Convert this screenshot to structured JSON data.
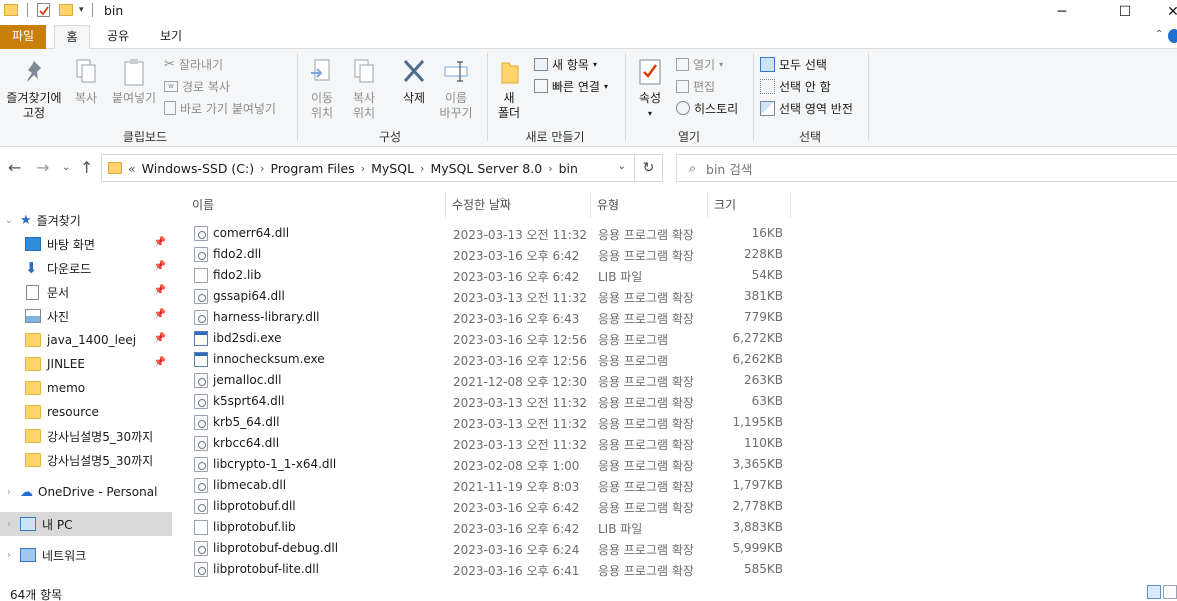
{
  "window": {
    "title": "bin",
    "minimize": "─",
    "maximize": "☐",
    "close": "✕"
  },
  "ribbon_tabs": [
    "파일",
    "홈",
    "공유",
    "보기"
  ],
  "ribbon": {
    "clipboard": {
      "pin_label": "즐겨찾기에\n고정",
      "copy_label": "복사",
      "paste_label": "붙여넣기",
      "cut_label": "잘라내기",
      "copy_path_label": "경로 복사",
      "paste_shortcut_label": "바로 가기 붙여넣기",
      "group_label": "클립보드"
    },
    "organize": {
      "move_label": "이동\n위치",
      "copyto_label": "복사\n위치",
      "delete_label": "삭제",
      "rename_label": "이름\n바꾸기",
      "group_label": "구성"
    },
    "new": {
      "new_folder_label": "새\n폴더",
      "new_item_label": "새 항목",
      "easy_access_label": "빠른 연결",
      "group_label": "새로 만들기"
    },
    "open": {
      "properties_label": "속성",
      "open_label": "열기",
      "edit_label": "편집",
      "history_label": "히스토리",
      "group_label": "열기"
    },
    "select": {
      "select_all_label": "모두 선택",
      "select_none_label": "선택 안 함",
      "invert_label": "선택 영역 반전",
      "group_label": "선택"
    }
  },
  "address": {
    "overflow": "«",
    "crumbs": [
      "Windows-SSD (C:)",
      "Program Files",
      "MySQL",
      "MySQL Server 8.0",
      "bin"
    ],
    "search_placeholder": "bin 검색"
  },
  "sidebar": {
    "items": [
      {
        "label": "즐겨찾기",
        "icon": "star-icon",
        "pinned": false
      },
      {
        "label": "바탕 화면",
        "icon": "desktop-icon",
        "pinned": true
      },
      {
        "label": "다운로드",
        "icon": "download-icon",
        "pinned": true
      },
      {
        "label": "문서",
        "icon": "document-icon",
        "pinned": true
      },
      {
        "label": "사진",
        "icon": "picture-icon",
        "pinned": true
      },
      {
        "label": "java_1400_leej",
        "icon": "folder-icon",
        "pinned": true
      },
      {
        "label": "JINLEE",
        "icon": "folder-icon",
        "pinned": true
      },
      {
        "label": "memo",
        "icon": "folder-icon",
        "pinned": false
      },
      {
        "label": "resource",
        "icon": "folder-icon",
        "pinned": false
      },
      {
        "label": "강사님설명5_30까지",
        "icon": "folder-icon",
        "pinned": false
      },
      {
        "label": "강사님설명5_30까지",
        "icon": "folder-icon",
        "pinned": false
      },
      {
        "label": "OneDrive - Personal",
        "icon": "cloud-icon",
        "pinned": false
      },
      {
        "label": "내 PC",
        "icon": "pc-icon",
        "pinned": false
      },
      {
        "label": "네트워크",
        "icon": "network-icon",
        "pinned": false
      }
    ]
  },
  "columns": {
    "name": "이름",
    "date": "수정한 날짜",
    "type": "유형",
    "size": "크기"
  },
  "files": [
    {
      "name": "comerr64.dll",
      "date": "2023-03-13 오전 11:32",
      "type": "응용 프로그램 확장",
      "size": "16KB",
      "kind": "dll"
    },
    {
      "name": "fido2.dll",
      "date": "2023-03-16 오후 6:42",
      "type": "응용 프로그램 확장",
      "size": "228KB",
      "kind": "dll"
    },
    {
      "name": "fido2.lib",
      "date": "2023-03-16 오후 6:42",
      "type": "LIB 파일",
      "size": "54KB",
      "kind": "lib"
    },
    {
      "name": "gssapi64.dll",
      "date": "2023-03-13 오전 11:32",
      "type": "응용 프로그램 확장",
      "size": "381KB",
      "kind": "dll"
    },
    {
      "name": "harness-library.dll",
      "date": "2023-03-16 오후 6:43",
      "type": "응용 프로그램 확장",
      "size": "779KB",
      "kind": "dll"
    },
    {
      "name": "ibd2sdi.exe",
      "date": "2023-03-16 오후 12:56",
      "type": "응용 프로그램",
      "size": "6,272KB",
      "kind": "exe"
    },
    {
      "name": "innochecksum.exe",
      "date": "2023-03-16 오후 12:56",
      "type": "응용 프로그램",
      "size": "6,262KB",
      "kind": "exe"
    },
    {
      "name": "jemalloc.dll",
      "date": "2021-12-08 오후 12:30",
      "type": "응용 프로그램 확장",
      "size": "263KB",
      "kind": "dll"
    },
    {
      "name": "k5sprt64.dll",
      "date": "2023-03-13 오전 11:32",
      "type": "응용 프로그램 확장",
      "size": "63KB",
      "kind": "dll"
    },
    {
      "name": "krb5_64.dll",
      "date": "2023-03-13 오전 11:32",
      "type": "응용 프로그램 확장",
      "size": "1,195KB",
      "kind": "dll"
    },
    {
      "name": "krbcc64.dll",
      "date": "2023-03-13 오전 11:32",
      "type": "응용 프로그램 확장",
      "size": "110KB",
      "kind": "dll"
    },
    {
      "name": "libcrypto-1_1-x64.dll",
      "date": "2023-02-08 오후 1:00",
      "type": "응용 프로그램 확장",
      "size": "3,365KB",
      "kind": "dll"
    },
    {
      "name": "libmecab.dll",
      "date": "2021-11-19 오후 8:03",
      "type": "응용 프로그램 확장",
      "size": "1,797KB",
      "kind": "dll"
    },
    {
      "name": "libprotobuf.dll",
      "date": "2023-03-16 오후 6:42",
      "type": "응용 프로그램 확장",
      "size": "2,778KB",
      "kind": "dll"
    },
    {
      "name": "libprotobuf.lib",
      "date": "2023-03-16 오후 6:42",
      "type": "LIB 파일",
      "size": "3,883KB",
      "kind": "lib"
    },
    {
      "name": "libprotobuf-debug.dll",
      "date": "2023-03-16 오후 6:24",
      "type": "응용 프로그램 확장",
      "size": "5,999KB",
      "kind": "dll"
    },
    {
      "name": "libprotobuf-lite.dll",
      "date": "2023-03-16 오후 6:41",
      "type": "응용 프로그램 확장",
      "size": "585KB",
      "kind": "dll"
    }
  ],
  "status": {
    "count": "64개 항목"
  },
  "colors": {
    "file_tab": "#c97f0c",
    "ribbon_bg": "#f5f6f7",
    "selected_bg": "#d9d9d9",
    "folder": "#ffd56b",
    "accent": "#2f6bc0"
  }
}
